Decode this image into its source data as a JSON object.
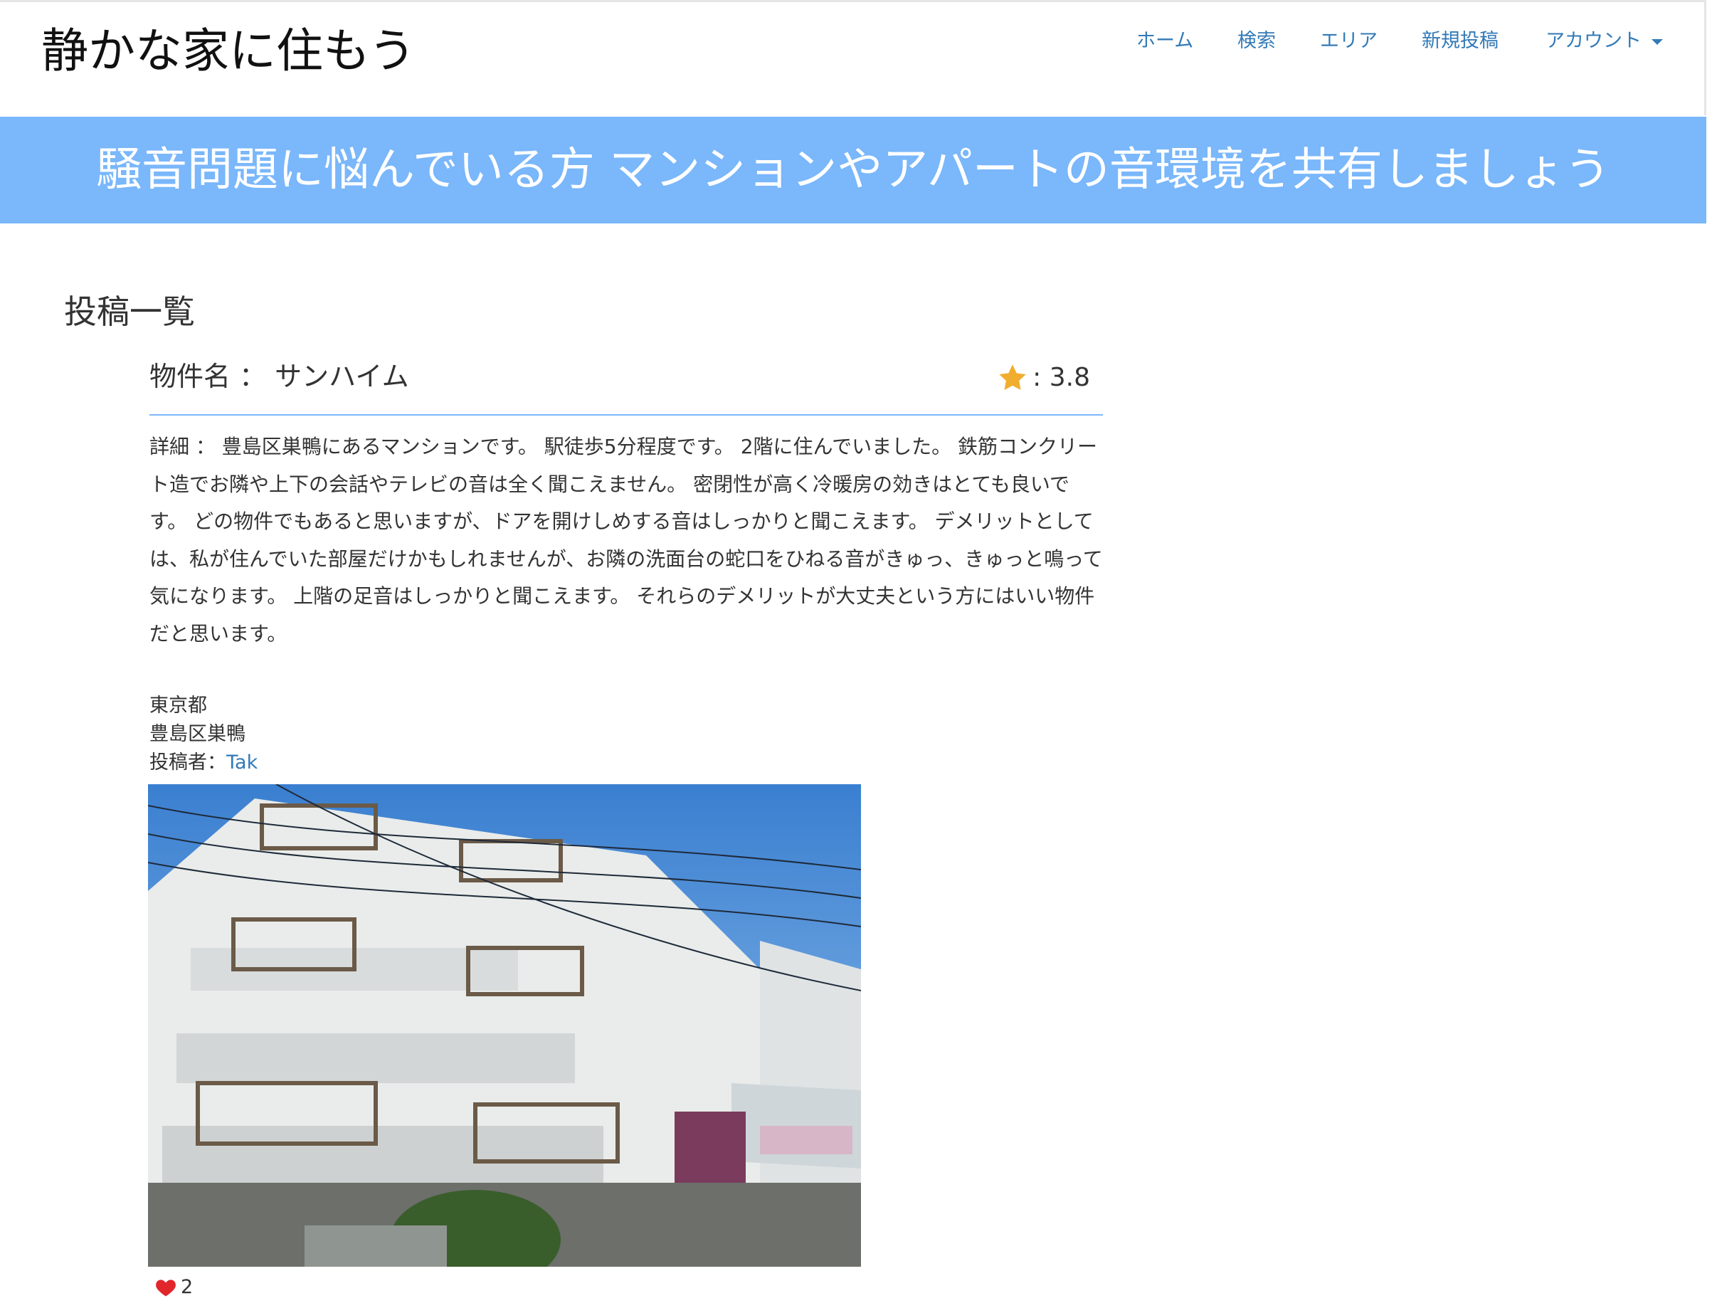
{
  "header": {
    "brand": "静かな家に住もう",
    "nav": {
      "home": "ホーム",
      "search": "検索",
      "area": "エリア",
      "new_post": "新規投稿",
      "account": "アカウント"
    }
  },
  "hero": {
    "text": "騒音問題に悩んでいる方 マンションやアパートの音環境を共有しましょう"
  },
  "main": {
    "section_title": "投稿一覧",
    "post": {
      "title": "物件名 ： サンハイム",
      "rating": ": 3.8",
      "detail": "詳細 ： 豊島区巣鴨にあるマンションです。 駅徒歩5分程度です。 2階に住んでいました。 鉄筋コンクリート造でお隣や上下の会話やテレビの音は全く聞こえません。 密閉性が高く冷暖房の効きはとても良いです。 どの物件でもあると思いますが、ドアを開けしめする音はしっかりと聞こえます。 デメリットとしては、私が住んでいた部屋だけかもしれませんが、お隣の洗面台の蛇口をひねる音がきゅっ、きゅっと鳴って気になります。 上階の足音はしっかりと聞こえます。 それらのデメリットが大丈夫という方にはいい物件だと思います。",
      "prefecture": "東京都",
      "city": "豊島区巣鴨",
      "author_label": "投稿者：",
      "author_name": "Tak",
      "likes": "2"
    }
  },
  "colors": {
    "hero_bg": "#7ab7fb",
    "link": "#337ab7",
    "star": "#f0ad2e",
    "heart": "#e0262b"
  }
}
